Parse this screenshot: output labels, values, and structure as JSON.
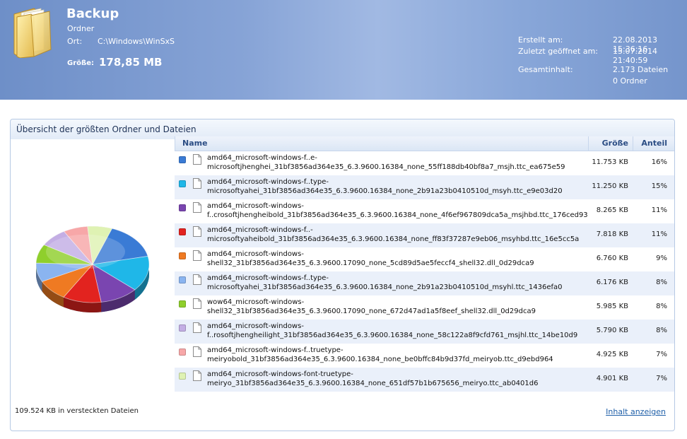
{
  "header": {
    "title": "Backup",
    "type": "Ordner",
    "location_label": "Ort:",
    "location_value": "C:\\Windows\\WinSxS",
    "size_label": "Größe:",
    "size_value": "178,85 MB",
    "created_label": "Erstellt am:",
    "created_value": "22.08.2013 15:36:16",
    "opened_label": "Zuletzt geöffnet am:",
    "opened_value": "15.07.2014 21:40:59",
    "content_label": "Gesamtinhalt:",
    "content_files": "2.173 Dateien",
    "content_folders": "0 Ordner",
    "icon": "folder-icon"
  },
  "panel": {
    "title": "Übersicht der größten Ordner und Dateien",
    "columns": {
      "name": "Name",
      "size": "Größe",
      "share": "Anteil"
    },
    "footer_hidden": "109.524 KB in versteckten Dateien",
    "footer_link": "Inhalt anzeigen"
  },
  "files": [
    {
      "line1": "amd64_microsoft-windows-f..e-",
      "line2": "microsoftjhenghei_31bf3856ad364e35_6.3.9600.16384_none_55ff188db40bf8a7_msjh.ttc_ea675e59",
      "size": "11.753 KB",
      "share": "16%",
      "color": "#3a7bd5"
    },
    {
      "line1": "amd64_microsoft-windows-f..type-",
      "line2": "microsoftyahei_31bf3856ad364e35_6.3.9600.16384_none_2b91a23b0410510d_msyh.ttc_e9e03d20",
      "size": "11.250 KB",
      "share": "15%",
      "color": "#1fb7e8"
    },
    {
      "line1": "amd64_microsoft-windows-",
      "line2": "f..crosoftjhengheibold_31bf3856ad364e35_6.3.9600.16384_none_4f6ef967809dca5a_msjhbd.ttc_176ced93",
      "size": "8.265 KB",
      "share": "11%",
      "color": "#7a45b0"
    },
    {
      "line1": "amd64_microsoft-windows-f..-",
      "line2": "microsoftyaheibold_31bf3856ad364e35_6.3.9600.16384_none_ff83f37287e9eb06_msyhbd.ttc_16e5cc5a",
      "size": "7.818 KB",
      "share": "11%",
      "color": "#e2231f"
    },
    {
      "line1": "amd64_microsoft-windows-",
      "line2": "shell32_31bf3856ad364e35_6.3.9600.17090_none_5cd89d5ae5feccf4_shell32.dll_0d29dca9",
      "size": "6.760 KB",
      "share": "9%",
      "color": "#ef7a22"
    },
    {
      "line1": "amd64_microsoft-windows-f..type-",
      "line2": "microsoftyahei_31bf3856ad364e35_6.3.9600.16384_none_2b91a23b0410510d_msyhl.ttc_1436efa0",
      "size": "6.176 KB",
      "share": "8%",
      "color": "#8ab4f0"
    },
    {
      "line1": "wow64_microsoft-windows-",
      "line2": "shell32_31bf3856ad364e35_6.3.9600.17090_none_672d47ad1a5f8eef_shell32.dll_0d29dca9",
      "size": "5.985 KB",
      "share": "8%",
      "color": "#8fcf2c"
    },
    {
      "line1": "amd64_microsoft-windows-",
      "line2": "f..rosoftjhengheilight_31bf3856ad364e35_6.3.9600.16384_none_58c122a8f9cfd761_msjhl.ttc_14be10d9",
      "size": "5.790 KB",
      "share": "8%",
      "color": "#c3aee4"
    },
    {
      "line1": "amd64_microsoft-windows-f..truetype-",
      "line2": "meiryobold_31bf3856ad364e35_6.3.9600.16384_none_be0bffc84b9d37fd_meiryob.ttc_d9ebd964",
      "size": "4.925 KB",
      "share": "7%",
      "color": "#f7a7a8"
    },
    {
      "line1": "amd64_microsoft-windows-font-truetype-",
      "line2": "meiryo_31bf3856ad364e35_6.3.9600.16384_none_651df57b1b675656_meiryo.ttc_ab0401d6",
      "size": "4.901 KB",
      "share": "7%",
      "color": "#dff2b3"
    }
  ]
}
